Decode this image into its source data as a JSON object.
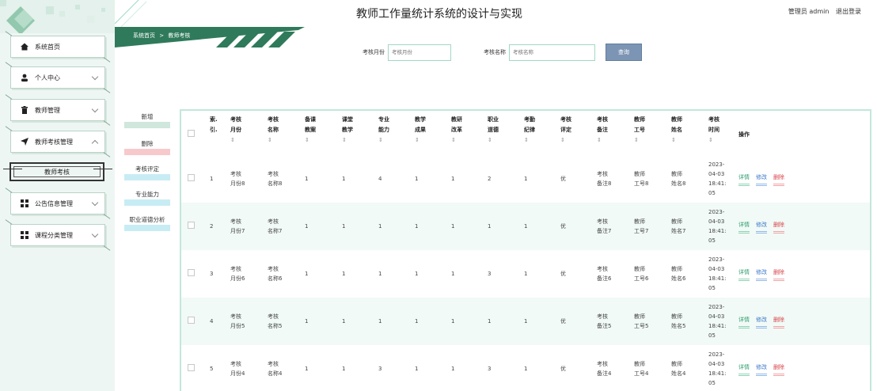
{
  "app": {
    "title": "教师工作量统计系统的设计与实现"
  },
  "user": {
    "role_name": "管理员 admin",
    "logout_label": "退出登录"
  },
  "breadcrumb": {
    "home": "系统首页",
    "separator": ">",
    "current": "教师考核"
  },
  "sidebar": {
    "items": [
      {
        "label": "系统首页",
        "icon": "home-icon"
      },
      {
        "label": "个人中心",
        "icon": "user-icon"
      },
      {
        "label": "教师管理",
        "icon": "trash-icon"
      },
      {
        "label": "教师考核管理",
        "icon": "send-icon"
      },
      {
        "label": "公告信息管理",
        "icon": "grid-icon"
      },
      {
        "label": "课程分类管理",
        "icon": "grid-icon"
      }
    ],
    "sub_item": {
      "label": "教师考核"
    }
  },
  "search": {
    "month_label": "考核月份",
    "month_placeholder": "考核月份",
    "name_label": "考核名称",
    "name_placeholder": "考核名称",
    "query_label": "查询"
  },
  "actions": {
    "add": "新增",
    "delete": "删除",
    "eval": "考核评定",
    "ability": "专业能力",
    "ethics": "职业道德分析"
  },
  "table": {
    "headers": [
      "索引",
      "考核月份",
      "考核名称",
      "备课教案",
      "课堂教学",
      "专业能力",
      "教学成果",
      "教研改革",
      "职业道德",
      "考勤纪律",
      "考核评定",
      "考核备注",
      "教师工号",
      "教师姓名",
      "考核时间",
      "操作"
    ],
    "header_lines": {
      "index": "索.\n引.",
      "month": "考核\n月份",
      "name": "考核\n名称",
      "prep": "备课\n教案",
      "teach": "课堂\n教学",
      "ability": "专业\n能力",
      "result": "教学\n成果",
      "reform": "教研\n改革",
      "ethics": "职业\n道德",
      "attendance": "考勤\n纪律",
      "eval": "考核\n评定",
      "remark": "考核\n备注",
      "tid": "教师\n工号",
      "tname": "教师\n姓名",
      "time": "考核\n时间",
      "op": "操作"
    },
    "sort_glyph": "⇕",
    "op_labels": {
      "detail": "详情",
      "edit": "修改",
      "delete": "删除"
    },
    "rows": [
      {
        "index": "1",
        "month": "考核\n月份8",
        "name": "考核\n名称8",
        "prep": "1",
        "teach": "1",
        "ability": "4",
        "result": "1",
        "reform": "1",
        "ethics": "2",
        "attendance": "1",
        "eval": "优",
        "remark": "考核\n备注8",
        "tid": "教师\n工号8",
        "tname": "教师\n姓名8",
        "time": "2023-\n04-03\n18:41:\n05"
      },
      {
        "index": "2",
        "month": "考核\n月份7",
        "name": "考核\n名称7",
        "prep": "1",
        "teach": "1",
        "ability": "1",
        "result": "1",
        "reform": "1",
        "ethics": "1",
        "attendance": "1",
        "eval": "优",
        "remark": "考核\n备注7",
        "tid": "教师\n工号7",
        "tname": "教师\n姓名7",
        "time": "2023-\n04-03\n18:41:\n05"
      },
      {
        "index": "3",
        "month": "考核\n月份6",
        "name": "考核\n名称6",
        "prep": "1",
        "teach": "1",
        "ability": "1",
        "result": "1",
        "reform": "1",
        "ethics": "3",
        "attendance": "1",
        "eval": "优",
        "remark": "考核\n备注6",
        "tid": "教师\n工号6",
        "tname": "教师\n姓名6",
        "time": "2023-\n04-03\n18:41:\n05"
      },
      {
        "index": "4",
        "month": "考核\n月份5",
        "name": "考核\n名称5",
        "prep": "1",
        "teach": "1",
        "ability": "1",
        "result": "1",
        "reform": "1",
        "ethics": "1",
        "attendance": "1",
        "eval": "优",
        "remark": "考核\n备注5",
        "tid": "教师\n工号5",
        "tname": "教师\n姓名5",
        "time": "2023-\n04-03\n18:41:\n05"
      },
      {
        "index": "5",
        "month": "考核\n月份4",
        "name": "考核\n名称4",
        "prep": "1",
        "teach": "1",
        "ability": "3",
        "result": "1",
        "reform": "1",
        "ethics": "3",
        "attendance": "1",
        "eval": "优",
        "remark": "考核\n备注4",
        "tid": "教师\n工号4",
        "tname": "教师\n姓名4",
        "time": "2023-\n04-03\n18:41:\n05"
      }
    ]
  },
  "colors": {
    "accent_green": "#9fd9c4",
    "band_green": "#2f7a5b",
    "query_button": "#7d95b4",
    "detail": "#2e9e6e",
    "edit": "#3a78c8",
    "delete": "#d9434a"
  }
}
